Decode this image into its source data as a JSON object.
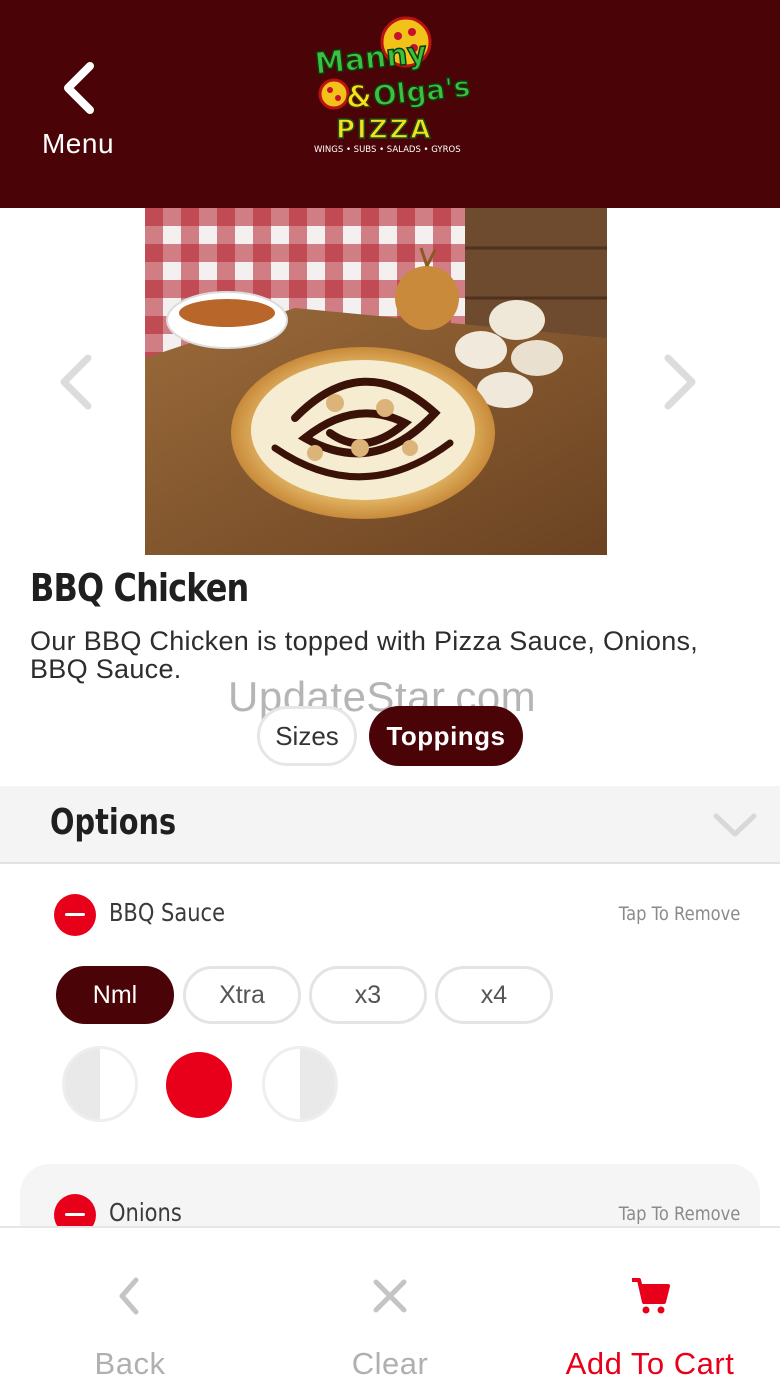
{
  "header": {
    "back_label": "Menu",
    "logo": {
      "line1": "Manny",
      "line2": "& Olga's",
      "line3": "PIZZA",
      "tagline": "WINGS • SUBS • SALADS • GYROS"
    }
  },
  "watermark": "UpdateStar.com",
  "item": {
    "title": "BBQ Chicken",
    "description": "Our BBQ Chicken is topped with Pizza Sauce, Onions, BBQ Sauce."
  },
  "tabs": [
    {
      "label": "Sizes",
      "active": false
    },
    {
      "label": "Toppings",
      "active": true
    }
  ],
  "options": {
    "title": "Options",
    "toppings": [
      {
        "name": "BBQ Sauce",
        "action": "Tap To Remove",
        "amounts": [
          "Nml",
          "Xtra",
          "x3",
          "x4"
        ],
        "selected_amount": "Nml",
        "portion_icons": [
          "left-half-icon",
          "whole-icon",
          "right-half-icon"
        ],
        "selected_portion": "whole"
      },
      {
        "name": "Onions",
        "action": "Tap To Remove"
      }
    ]
  },
  "bottom_bar": {
    "back_label": "Back",
    "clear_label": "Clear",
    "cart_label": "Add To Cart"
  },
  "colors": {
    "brand": "#4a0408",
    "accent": "#e8001a",
    "muted": "#b0b0b0"
  }
}
